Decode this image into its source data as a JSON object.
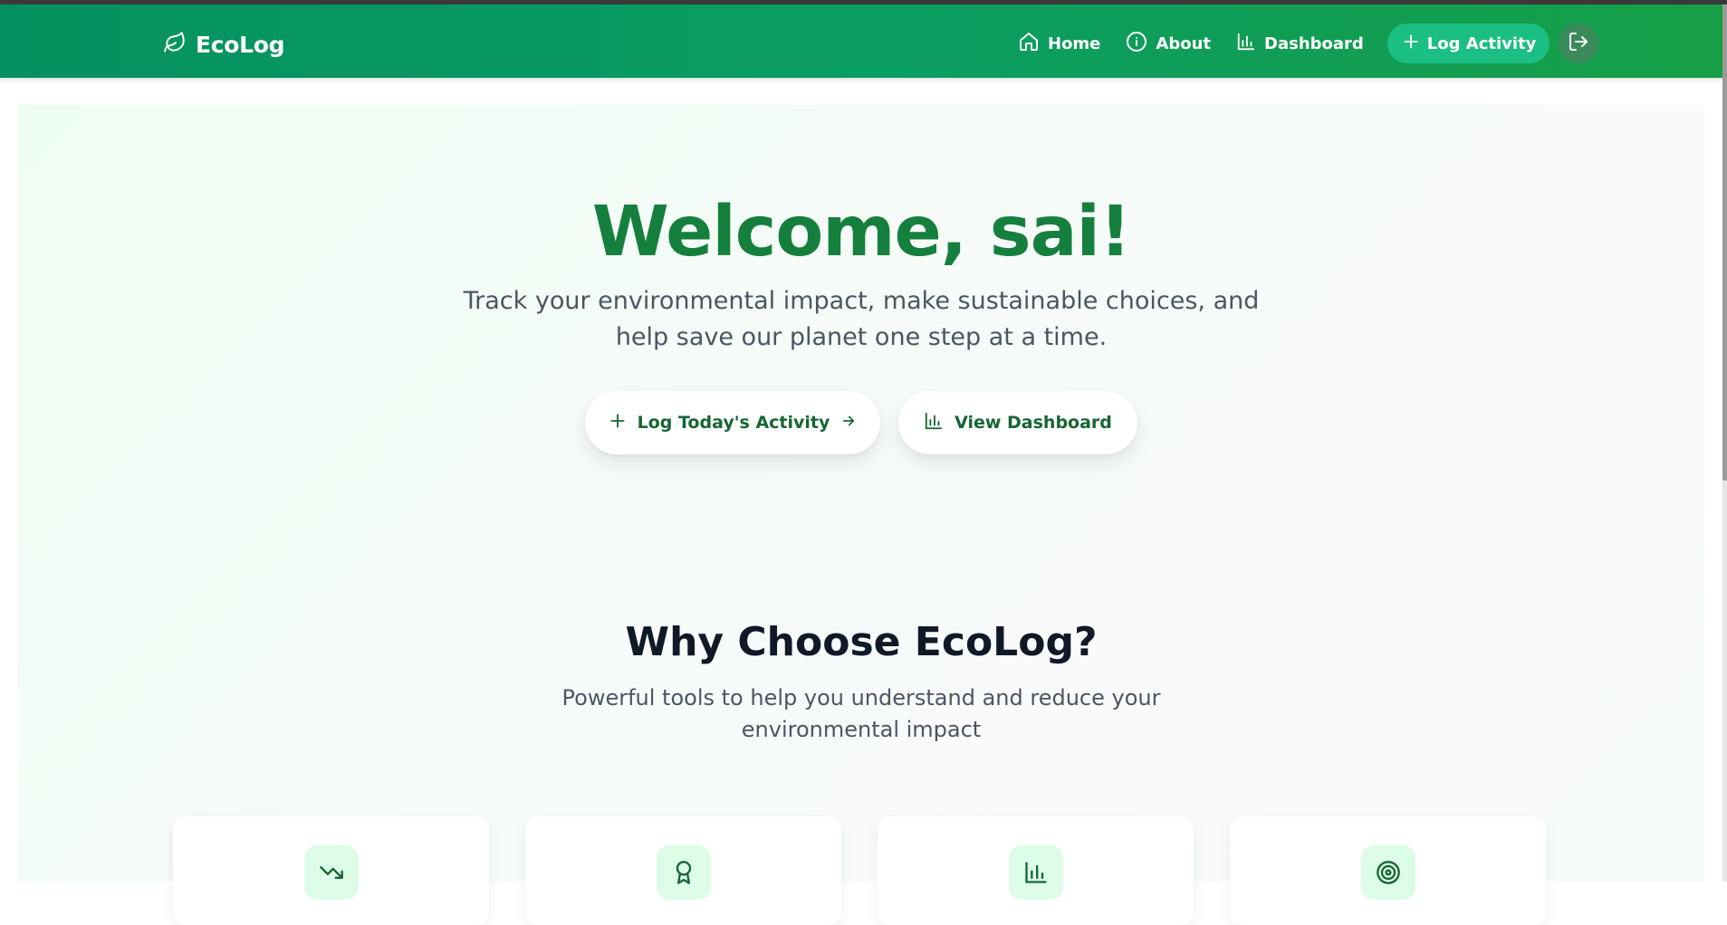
{
  "app": {
    "brand": "EcoLog"
  },
  "nav": {
    "items": [
      {
        "label": "Home",
        "icon": "home-icon"
      },
      {
        "label": "About",
        "icon": "info-icon"
      },
      {
        "label": "Dashboard",
        "icon": "bar-chart-icon"
      }
    ],
    "cta_label": "Log Activity",
    "cta_icon": "plus-icon",
    "logout_icon": "logout-icon"
  },
  "hero": {
    "title": "Welcome, sai!",
    "subtitle": "Track your environmental impact, make sustainable choices, and help save our planet one step at a time.",
    "primary_button": "Log Today's Activity",
    "secondary_button": "View Dashboard"
  },
  "features": {
    "title": "Why Choose EcoLog?",
    "subtitle": "Powerful tools to help you understand and reduce your environmental impact",
    "cards": [
      {
        "icon": "trending-down-icon"
      },
      {
        "icon": "award-icon"
      },
      {
        "icon": "bar-chart-icon"
      },
      {
        "icon": "target-icon"
      }
    ]
  },
  "colors": {
    "nav_bg": "#0a9d63",
    "cta_bg": "#1bbf83",
    "title_green": "#15803d",
    "button_text": "#166534",
    "icon_bg": "#dcfce7"
  }
}
